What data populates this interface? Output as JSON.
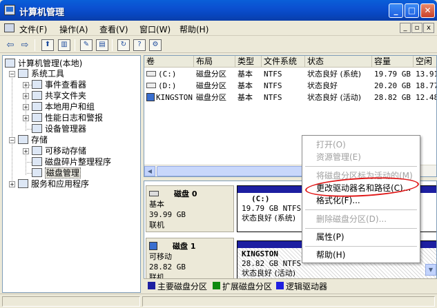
{
  "window": {
    "title": "计算机管理",
    "controls": {
      "minimize": "_",
      "maximize": "□",
      "close": "✕"
    }
  },
  "menubar": {
    "items": [
      "文件(F)",
      "操作(A)",
      "查看(V)",
      "窗口(W)",
      "帮助(H)"
    ],
    "mdi_controls": [
      "_",
      "▫",
      "x"
    ]
  },
  "toolbar": {
    "icons": [
      "back-arrow-icon",
      "forward-arrow-icon",
      "up-folder-icon",
      "show-hide-tree-icon",
      "properties-icon",
      "export-list-icon",
      "refresh-icon",
      "help-icon",
      "settings-icon"
    ]
  },
  "tree": {
    "root": "计算机管理(本地)",
    "system_tools": "系统工具",
    "event_viewer": "事件查看器",
    "shared_folders": "共享文件夹",
    "local_users": "本地用户和组",
    "perf_logs": "性能日志和警报",
    "device_manager": "设备管理器",
    "storage": "存储",
    "removable_storage": "可移动存储",
    "defrag": "磁盘碎片整理程序",
    "disk_mgmt": "磁盘管理",
    "services": "服务和应用程序"
  },
  "volume_table": {
    "headers": [
      "卷",
      "布局",
      "类型",
      "文件系统",
      "状态",
      "容量",
      "空闲"
    ],
    "rows": [
      {
        "volume": "(C:)",
        "layout": "磁盘分区",
        "type": "基本",
        "fs": "NTFS",
        "status": "状态良好 (系统)",
        "capacity": "19.79 GB",
        "free": "13.91"
      },
      {
        "volume": "(D:)",
        "layout": "磁盘分区",
        "type": "基本",
        "fs": "NTFS",
        "status": "状态良好",
        "capacity": "20.20 GB",
        "free": "18.77"
      },
      {
        "volume": "KINGSTON",
        "layout": "磁盘分区",
        "type": "基本",
        "fs": "NTFS",
        "status": "状态良好 (活动)",
        "capacity": "28.82 GB",
        "free": "12.48"
      }
    ]
  },
  "disks": [
    {
      "name": "磁盘 0",
      "type": "基本",
      "size": "39.99 GB",
      "state": "联机",
      "partition": {
        "label": "(C:)",
        "detail": "19.79 GB NTFS",
        "status": "状态良好 (系统)"
      }
    },
    {
      "name": "磁盘 1",
      "type": "可移动",
      "size": "28.82 GB",
      "state": "联机",
      "partition": {
        "label": "KINGSTON",
        "detail": "28.82 GB NTFS",
        "status": "状态良好 (活动)"
      }
    }
  ],
  "legend": [
    {
      "label": "主要磁盘分区",
      "color": "#1d1fa1"
    },
    {
      "label": "扩展磁盘分区",
      "color": "#0f8a0f"
    },
    {
      "label": "逻辑驱动器",
      "color": "#1f1fe0"
    }
  ],
  "context_menu": {
    "open": "打开(O)",
    "explore": "资源管理(E)",
    "mark_active": "将磁盘分区标为活动的(M)",
    "change_letter": "更改驱动器名和路径(C)...",
    "format": "格式化(F)...",
    "delete": "删除磁盘分区(D)...",
    "properties": "属性(P)",
    "help": "帮助(H)"
  },
  "colors": {
    "annotation": "#e01717",
    "titlebar": "#0a4fd0",
    "partition_bar": "#1d1fa1"
  }
}
